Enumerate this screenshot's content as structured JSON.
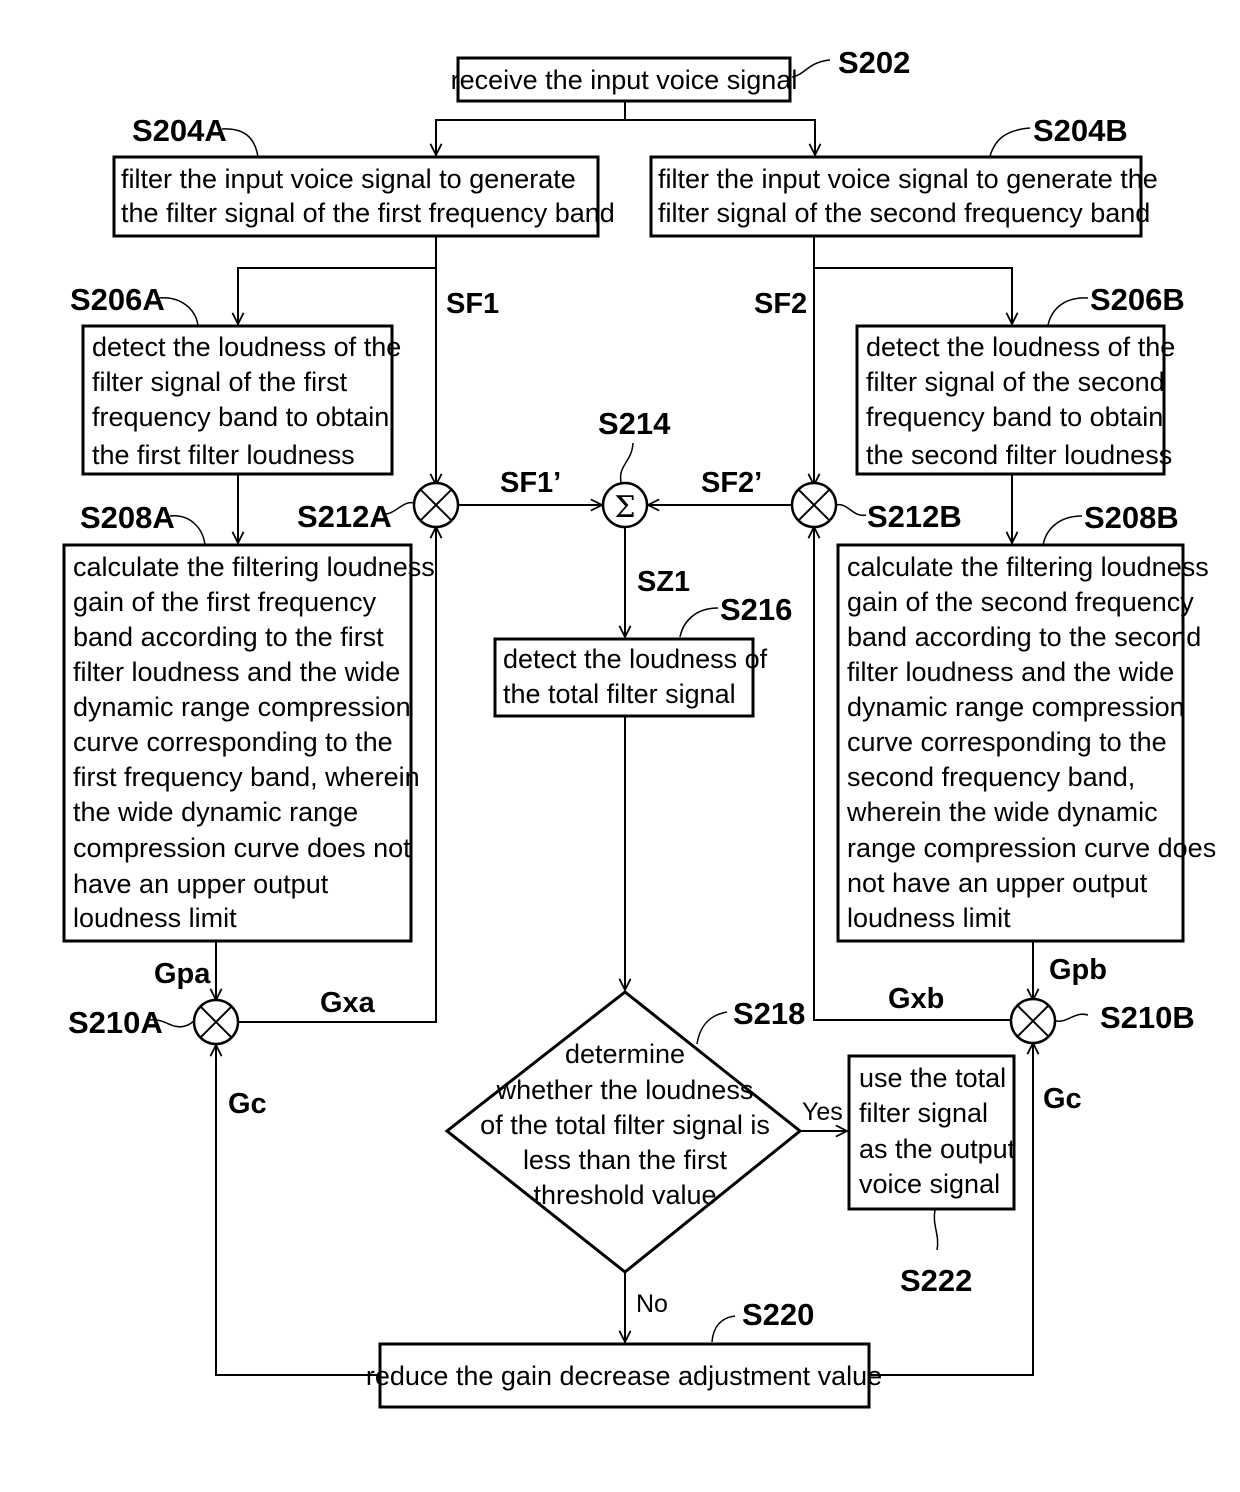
{
  "steps": {
    "s202": {
      "id": "S202",
      "lines": [
        "receive the input voice signal"
      ]
    },
    "s204a": {
      "id": "S204A",
      "lines": [
        "filter the input voice signal to generate",
        "the filter signal of the first frequency band"
      ]
    },
    "s204b": {
      "id": "S204B",
      "lines": [
        "filter the input voice signal to generate the",
        "filter signal of the second frequency band"
      ]
    },
    "s206a": {
      "id": "S206A",
      "lines": [
        "detect the loudness of the",
        "filter signal of the first",
        "frequency band to obtain",
        "the first filter loudness"
      ]
    },
    "s206b": {
      "id": "S206B",
      "lines": [
        "detect the loudness of the",
        "filter signal of the second",
        "frequency band to obtain",
        "the second filter loudness"
      ]
    },
    "s208a": {
      "id": "S208A",
      "lines": [
        "calculate the filtering loudness",
        "gain of the first frequency",
        "band according to the first",
        "filter loudness and the wide",
        "dynamic range compression",
        "curve corresponding to the",
        "first frequency band, wherein",
        "the wide dynamic range",
        "compression curve does not",
        "have an upper output",
        "loudness limit"
      ]
    },
    "s208b": {
      "id": "S208B",
      "lines": [
        "calculate the filtering loudness",
        "gain of the second frequency",
        "band according to the second",
        "filter loudness and the wide",
        "dynamic range compression",
        "curve corresponding to the",
        "second frequency band,",
        "wherein the wide dynamic",
        "range compression curve does",
        "not have an upper output",
        "loudness limit"
      ]
    },
    "s210a": {
      "id": "S210A",
      "symbol": "multiply-icon"
    },
    "s210b": {
      "id": "S210B",
      "symbol": "multiply-icon"
    },
    "s212a": {
      "id": "S212A",
      "symbol": "multiply-icon"
    },
    "s212b": {
      "id": "S212B",
      "symbol": "multiply-icon"
    },
    "s214": {
      "id": "S214",
      "symbol": "Σ"
    },
    "s216": {
      "id": "S216",
      "lines": [
        "detect the loudness of",
        "the total filter signal"
      ]
    },
    "s218": {
      "id": "S218",
      "lines": [
        "determine",
        "whether the loudness",
        "of the total filter signal is",
        "less than the first",
        "threshold value"
      ]
    },
    "s220": {
      "id": "S220",
      "lines": [
        "reduce the gain decrease adjustment value"
      ]
    },
    "s222": {
      "id": "S222",
      "lines": [
        "use the total",
        "filter signal",
        "as the output",
        "voice signal"
      ]
    }
  },
  "signals": {
    "sf1": "SF1",
    "sf2": "SF2",
    "sf1p": "SF1’",
    "sf2p": "SF2’",
    "sz1": "SZ1",
    "gpa": "Gpa",
    "gpb": "Gpb",
    "gxa": "Gxa",
    "gxb": "Gxb",
    "gc_left": "Gc",
    "gc_right": "Gc"
  },
  "branches": {
    "yes": "Yes",
    "no": "No"
  }
}
